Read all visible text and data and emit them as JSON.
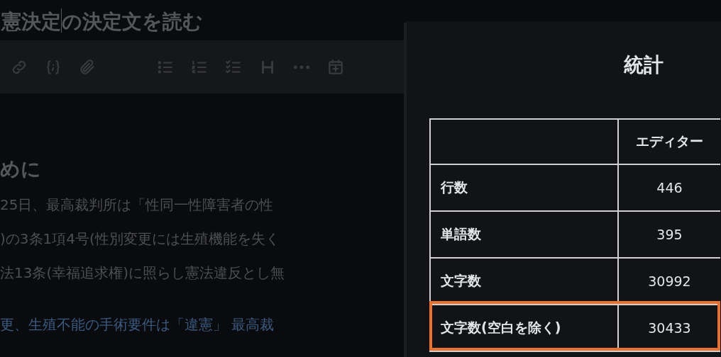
{
  "editor": {
    "title_before_caret": "憲決定",
    "title_after_caret": "の決定文を読む",
    "heading": "めに",
    "paragraph_lines": [
      "25日、最高裁判所は「性同一性障害者の性",
      ")の3条1項4号(性別変更には生殖機能を失く",
      "法13条(幸福追求権)に照らし憲法違反とし無"
    ],
    "link_line": "更、生殖不能の手術要件は「違憲」 最高裁"
  },
  "stats_panel": {
    "title": "統計",
    "header": "エディター",
    "rows": [
      {
        "label": "行数",
        "value": "446",
        "highlighted": false
      },
      {
        "label": "単語数",
        "value": "395",
        "highlighted": false
      },
      {
        "label": "文字数",
        "value": "30992",
        "highlighted": false
      },
      {
        "label": "文字数(空白を除く)",
        "value": "30433",
        "highlighted": true
      }
    ]
  }
}
